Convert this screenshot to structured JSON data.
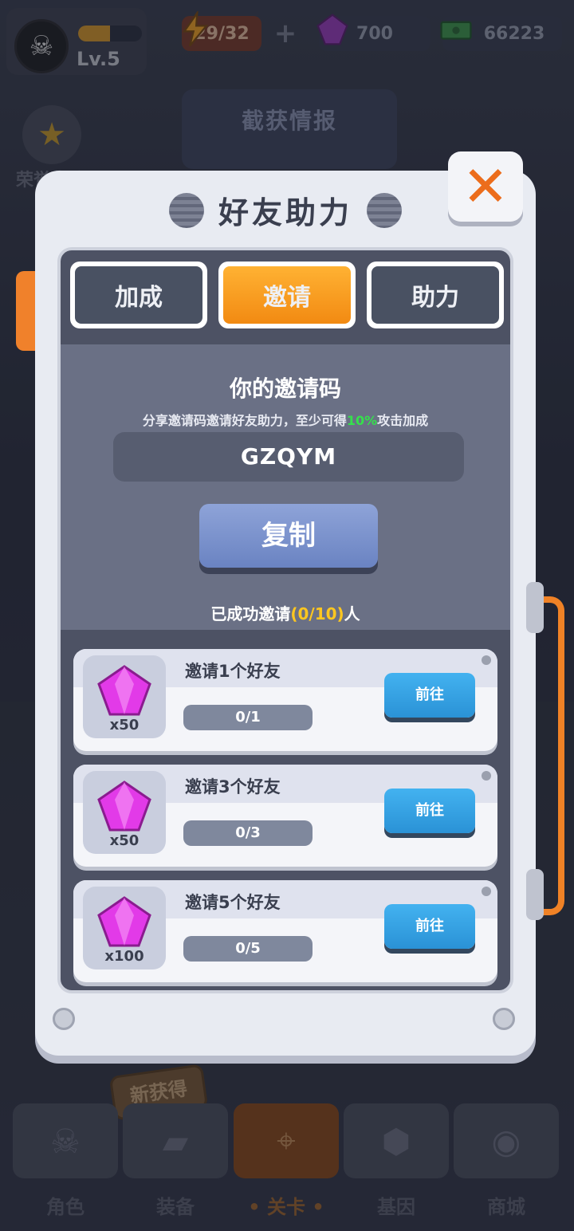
{
  "topbar": {
    "level": "Lv.5",
    "level_progress": 0.5,
    "energy": "29/32",
    "gems": "700",
    "cash": "66223"
  },
  "background": {
    "intel_title": "截获情报",
    "honor_label": "荣誉大路"
  },
  "modal": {
    "title": "好友助力",
    "tabs": [
      {
        "label": "加成",
        "active": false
      },
      {
        "label": "邀请",
        "active": true
      },
      {
        "label": "助力",
        "active": false
      }
    ],
    "invite": {
      "title": "你的邀请码",
      "subtitle_prefix": "分享邀请码邀请好友助力，至少可得",
      "subtitle_pct": "10%",
      "subtitle_suffix": "攻击加成",
      "code": "GZQYM",
      "copy_label": "复制",
      "invited_prefix": "已成功邀请",
      "invited_count": "(0/10)",
      "invited_suffix": "人"
    },
    "tasks": [
      {
        "name": "邀请1个好友",
        "reward_qty": "x50",
        "progress": "0/1",
        "button": "前往"
      },
      {
        "name": "邀请3个好友",
        "reward_qty": "x50",
        "progress": "0/3",
        "button": "前往"
      },
      {
        "name": "邀请5个好友",
        "reward_qty": "x100",
        "progress": "0/5",
        "button": "前往"
      }
    ]
  },
  "bottom_nav": {
    "new_badge": "新获得",
    "items": [
      {
        "label": "角色",
        "icon": "skull-icon",
        "active": false
      },
      {
        "label": "装备",
        "icon": "gun-icon",
        "active": false
      },
      {
        "label": "• 关卡 •",
        "icon": "map-pin-icon",
        "active": true
      },
      {
        "label": "基因",
        "icon": "hexagon-icon",
        "active": false
      },
      {
        "label": "商城",
        "icon": "shop-icon",
        "active": false
      }
    ]
  },
  "colors": {
    "accent_orange": "#f28a12",
    "close_x": "#ec6d1c",
    "highlight_green": "#35e04c",
    "highlight_yellow": "#ffc71f",
    "go_blue": "#2a92d6"
  }
}
